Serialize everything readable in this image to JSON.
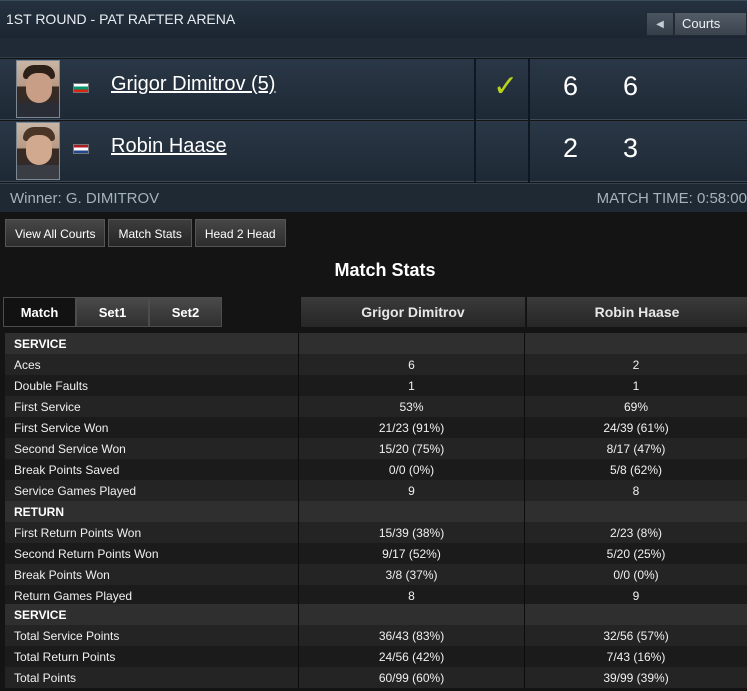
{
  "header": {
    "round_title": "1ST ROUND - PAT RAFTER ARENA",
    "courts_label": "Courts",
    "prev_icon": "chevron-left-icon"
  },
  "players": [
    {
      "name": "Grigor Dimitrov (5)",
      "flag": "bulgaria-flag",
      "winner": true,
      "sets": [
        "6",
        "6"
      ]
    },
    {
      "name": "Robin Haase",
      "flag": "netherlands-flag",
      "winner": false,
      "sets": [
        "2",
        "3"
      ]
    }
  ],
  "check_mark": "✓",
  "result": {
    "winner_text": "Winner: G. DIMITROV",
    "match_time": "MATCH TIME: 0:58:00"
  },
  "tabs": [
    "View All Courts",
    "Match Stats",
    "Head 2 Head"
  ],
  "stats": {
    "title": "Match Stats",
    "set_tabs": [
      "Match",
      "Set1",
      "Set2"
    ],
    "player1": "Grigor Dimitrov",
    "player2": "Robin Haase",
    "rows": [
      {
        "type": "section",
        "label": "SERVICE",
        "v1": "",
        "v2": ""
      },
      {
        "type": "stat",
        "label": "Aces",
        "v1": "6",
        "v2": "2"
      },
      {
        "type": "stat",
        "label": "Double Faults",
        "v1": "1",
        "v2": "1"
      },
      {
        "type": "stat",
        "label": "First Service",
        "v1": "53%",
        "v2": "69%"
      },
      {
        "type": "stat",
        "label": "First Service Won",
        "v1": "21/23 (91%)",
        "v2": "24/39 (61%)"
      },
      {
        "type": "stat",
        "label": "Second Service Won",
        "v1": "15/20 (75%)",
        "v2": "8/17 (47%)"
      },
      {
        "type": "stat",
        "label": "Break Points Saved",
        "v1": "0/0 (0%)",
        "v2": "5/8 (62%)"
      },
      {
        "type": "stat",
        "label": "Service Games Played",
        "v1": "9",
        "v2": "8"
      },
      {
        "type": "section",
        "label": "RETURN",
        "v1": "",
        "v2": ""
      },
      {
        "type": "stat",
        "label": "First Return Points Won",
        "v1": "15/39 (38%)",
        "v2": "2/23 (8%)"
      },
      {
        "type": "stat",
        "label": "Second Return Points Won",
        "v1": "9/17 (52%)",
        "v2": "5/20 (25%)"
      },
      {
        "type": "stat",
        "label": "Break Points Won",
        "v1": "3/8 (37%)",
        "v2": "0/0 (0%)"
      },
      {
        "type": "stat",
        "label": "Return Games Played",
        "v1": "8",
        "v2": "9"
      },
      {
        "type": "section",
        "label": "SERVICE",
        "v1": "",
        "v2": ""
      },
      {
        "type": "stat",
        "label": "Total Service Points",
        "v1": "36/43 (83%)",
        "v2": "32/56 (57%)"
      },
      {
        "type": "stat",
        "label": "Total Return Points",
        "v1": "24/56 (42%)",
        "v2": "7/43 (16%)"
      },
      {
        "type": "stat",
        "label": "Total Points",
        "v1": "60/99 (60%)",
        "v2": "39/99 (39%)"
      }
    ]
  }
}
